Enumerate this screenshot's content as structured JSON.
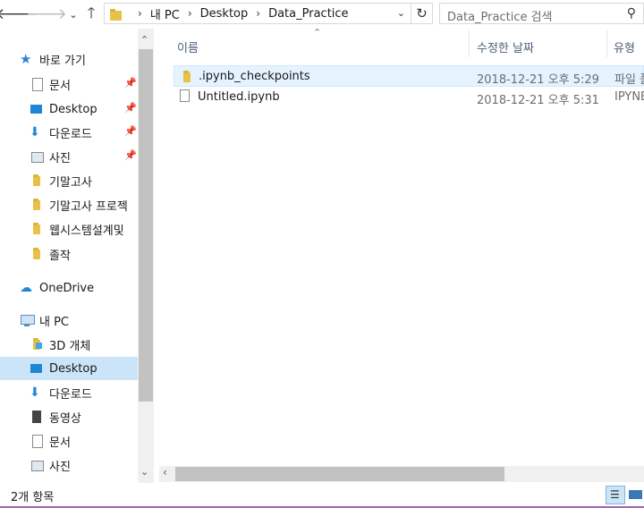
{
  "address": {
    "crumbs": [
      "내 PC",
      "Desktop",
      "Data_Practice"
    ]
  },
  "search": {
    "placeholder": "Data_Practice 검색"
  },
  "nav": {
    "quick_access": "바로 가기",
    "quick_items": [
      "문서",
      "Desktop",
      "다운로드",
      "사진",
      "기말고사",
      "기말고사 프로젝",
      "웹시스템설계및",
      "졸작"
    ],
    "onedrive": "OneDrive",
    "this_pc": "내 PC",
    "pc_items": [
      "3D 개체",
      "Desktop",
      "다운로드",
      "동영상",
      "문서",
      "사진"
    ]
  },
  "columns": {
    "name": "이름",
    "date": "수정한 날짜",
    "type": "유형"
  },
  "files": [
    {
      "name": ".ipynb_checkpoints",
      "date": "2018-12-21 오후 5:29",
      "type": "파일 폴",
      "icon": "folder-icon"
    },
    {
      "name": "Untitled.ipynb",
      "date": "2018-12-21 오후 5:31",
      "type": "IPYNB",
      "icon": "file-icon"
    }
  ],
  "status": {
    "count": "2개 항목"
  },
  "colors": {
    "folder": "#e8c146",
    "selection": "#cce4f7",
    "hover": "#e5f3ff",
    "header_text": "#4c607a"
  }
}
